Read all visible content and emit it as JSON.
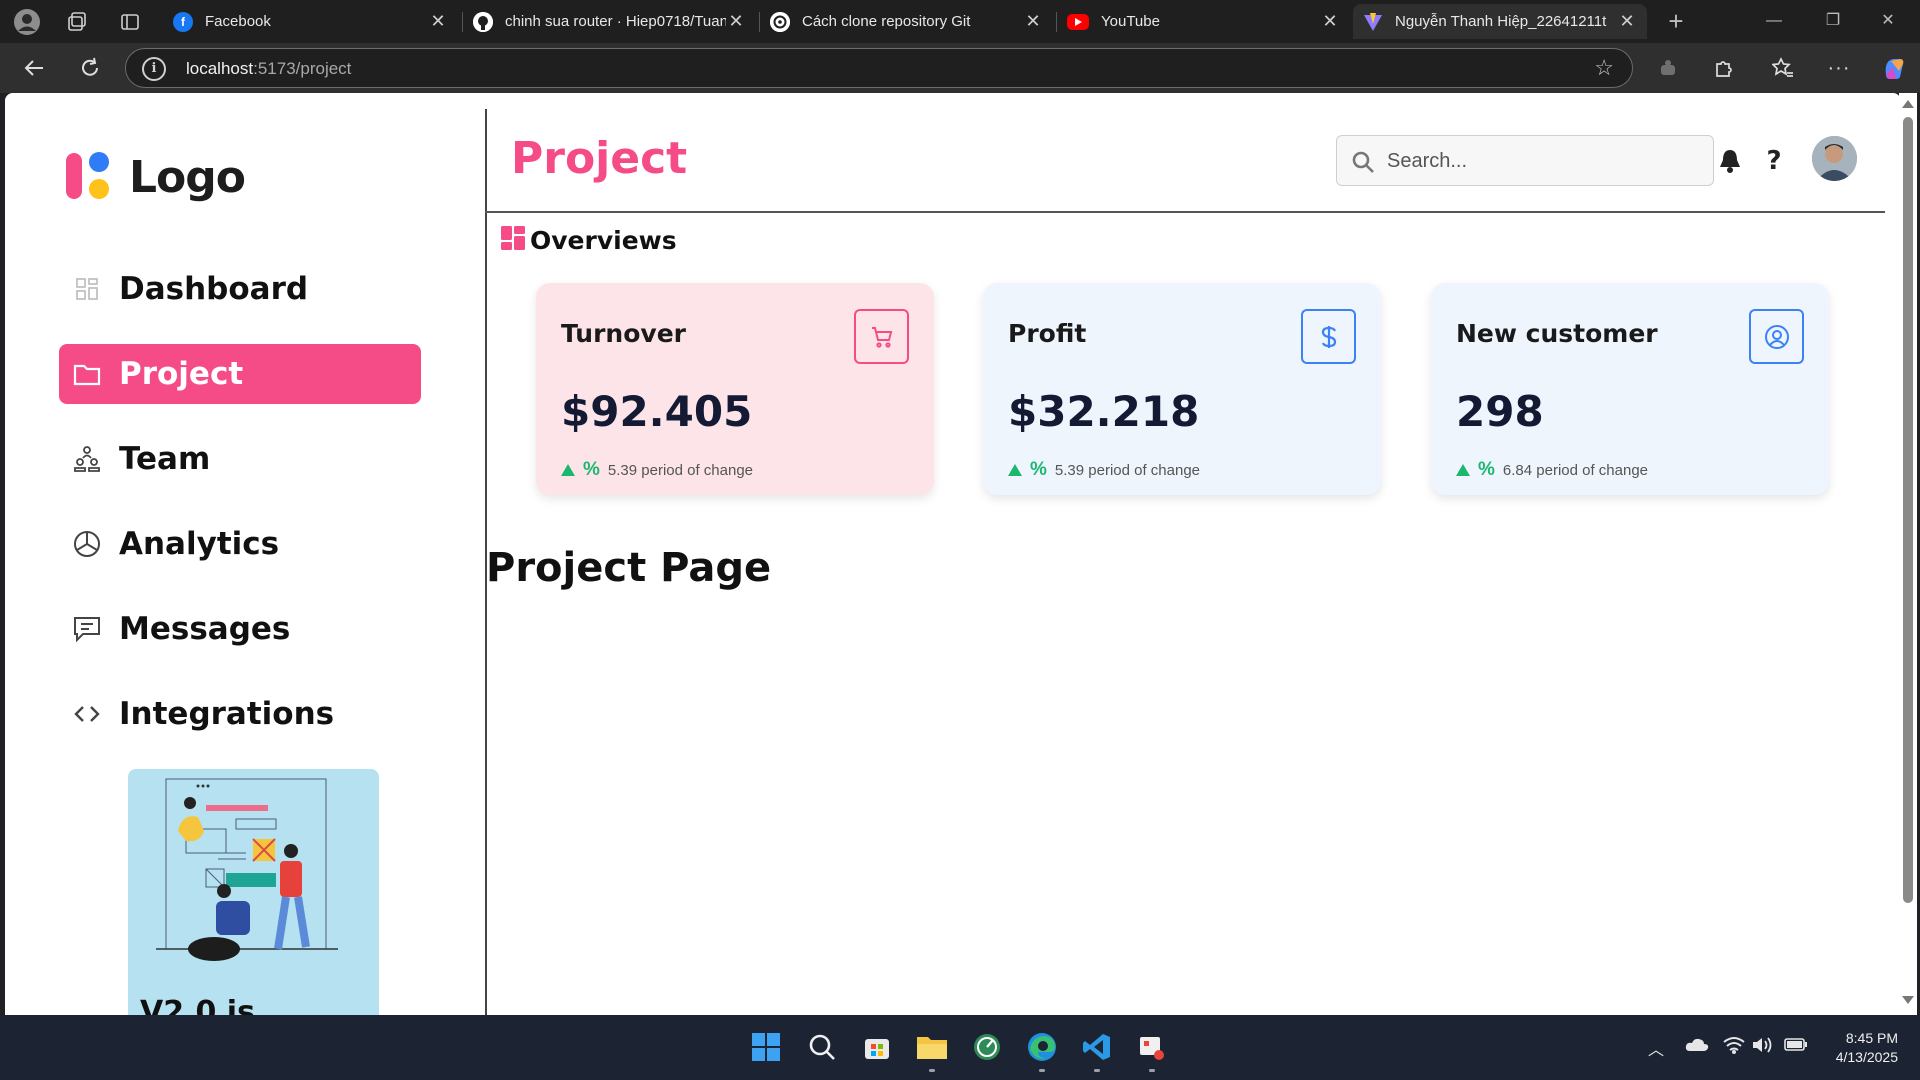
{
  "browser": {
    "tabs": [
      {
        "title": "Facebook",
        "favicon": "facebook-icon",
        "color": "#1877f2",
        "active": false
      },
      {
        "title": "chinh sua router · Hiep0718/Tuan",
        "favicon": "github-icon",
        "color": "#ffffff",
        "active": false
      },
      {
        "title": "Cách clone repository Git",
        "favicon": "openai-icon",
        "color": "#ffffff",
        "active": false
      },
      {
        "title": "YouTube",
        "favicon": "youtube-icon",
        "color": "#ff0000",
        "active": false
      },
      {
        "title": "Nguyễn Thanh Hiệp_22641211t",
        "favicon": "vite-icon",
        "color": "#bd34fe",
        "active": true
      }
    ],
    "url_host": "localhost",
    "url_rest": ":5173/project"
  },
  "sidebar": {
    "logo_text": "Logo",
    "items": [
      {
        "label": "Dashboard",
        "icon": "grid-icon",
        "active": false
      },
      {
        "label": "Project",
        "icon": "folder-icon",
        "active": true
      },
      {
        "label": "Team",
        "icon": "team-icon",
        "active": false
      },
      {
        "label": "Analytics",
        "icon": "pie-chart-icon",
        "active": false
      },
      {
        "label": "Messages",
        "icon": "message-icon",
        "active": false
      },
      {
        "label": "Integrations",
        "icon": "code-icon",
        "active": false
      }
    ],
    "promo_title": "V2.0 is"
  },
  "header": {
    "title": "Project",
    "search_placeholder": "Search...",
    "help_label": "?"
  },
  "overview": {
    "title": "Overviews",
    "cards": [
      {
        "title": "Turnover",
        "value": "$92.405",
        "pct_symbol": "%",
        "change": "5.39 period of change",
        "icon": "cart-icon",
        "bg": "#fde4e8",
        "accent": "#f54c88"
      },
      {
        "title": "Profit",
        "value": "$32.218",
        "pct_symbol": "%",
        "change": "5.39 period of change",
        "icon": "dollar-icon",
        "bg": "#eef5fd",
        "accent": "#3b82f6"
      },
      {
        "title": "New customer",
        "value": "298",
        "pct_symbol": "%",
        "change": "6.84 period of change",
        "icon": "user-circle-icon",
        "bg": "#eef5fd",
        "accent": "#3b82f6"
      }
    ]
  },
  "page": {
    "heading": "Project Page"
  },
  "taskbar": {
    "time": "8:45 PM",
    "date": "4/13/2025"
  }
}
